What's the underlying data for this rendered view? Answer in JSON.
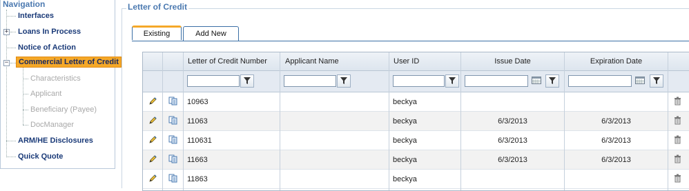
{
  "navigation": {
    "title": "Navigation",
    "items": [
      {
        "label": "Interfaces"
      },
      {
        "label": "Loans In Process"
      },
      {
        "label": "Notice of Action"
      },
      {
        "label": "Commercial Letter of Credit"
      },
      {
        "label": "ARM/HE Disclosures"
      },
      {
        "label": "Quick Quote"
      }
    ],
    "sub_items": [
      {
        "label": "Characteristics"
      },
      {
        "label": "Applicant"
      },
      {
        "label": "Beneficiary (Payee)"
      },
      {
        "label": "DocManager"
      }
    ]
  },
  "main": {
    "title": "Letter of Credit",
    "tabs": [
      {
        "label": "Existing"
      },
      {
        "label": "Add New"
      }
    ],
    "columns": [
      "Letter of Credit Number",
      "Applicant Name",
      "User ID",
      "Issue Date",
      "Expiration Date"
    ],
    "rows": [
      {
        "number": "10963",
        "applicant": "",
        "user": "beckya",
        "issue": "",
        "expiration": ""
      },
      {
        "number": "11063",
        "applicant": "",
        "user": "beckya",
        "issue": "6/3/2013",
        "expiration": "6/3/2013"
      },
      {
        "number": "110631",
        "applicant": "",
        "user": "beckya",
        "issue": "6/3/2013",
        "expiration": "6/3/2013"
      },
      {
        "number": "11663",
        "applicant": "",
        "user": "beckya",
        "issue": "6/3/2013",
        "expiration": "6/3/2013"
      },
      {
        "number": "11863",
        "applicant": "",
        "user": "beckya",
        "issue": "",
        "expiration": ""
      }
    ]
  },
  "colors": {
    "accent": "#f5a828",
    "title_blue": "#4b79b0",
    "nav_text": "#1a3a78"
  },
  "icons": [
    "plus-icon",
    "minus-icon",
    "edit-icon",
    "copy-icon",
    "filter-icon",
    "calendar-icon",
    "trash-icon"
  ]
}
